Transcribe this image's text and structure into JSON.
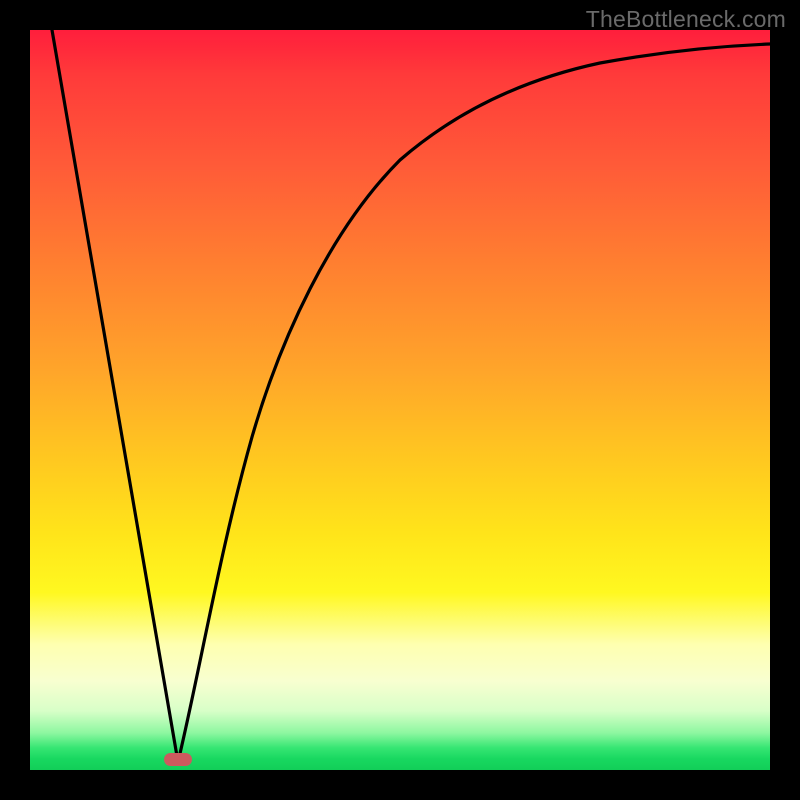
{
  "watermark": "TheBottleneck.com",
  "chart_data": {
    "type": "line",
    "title": "",
    "xlabel": "",
    "ylabel": "",
    "xlim": [
      0,
      100
    ],
    "ylim": [
      0,
      100
    ],
    "x": [
      3,
      5,
      7,
      9,
      11,
      13,
      15,
      17,
      19,
      20,
      21,
      22,
      24,
      26,
      28,
      30,
      33,
      36,
      40,
      45,
      50,
      55,
      60,
      65,
      70,
      75,
      80,
      85,
      90,
      95,
      100
    ],
    "values": [
      100,
      89,
      78,
      67,
      56,
      45,
      34,
      23,
      12,
      6,
      2,
      5,
      15,
      26,
      36,
      45,
      53,
      60,
      67,
      74,
      79,
      83,
      86,
      88.5,
      90.5,
      92,
      93.2,
      94.2,
      95,
      95.7,
      96.2
    ],
    "marker": {
      "x": 20,
      "y": 1
    },
    "annotations": []
  },
  "colors": {
    "curve": "#000000",
    "marker": "#cc5a5e",
    "frame": "#000000"
  }
}
